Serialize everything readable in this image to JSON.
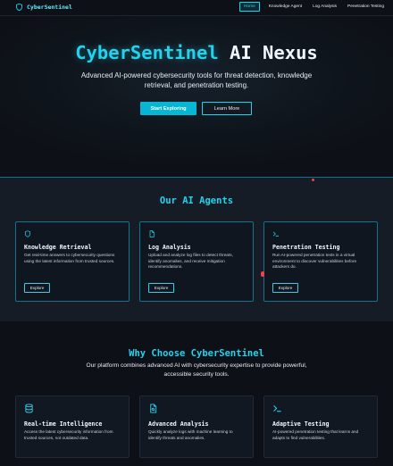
{
  "brand": {
    "name": "CyberSentinel",
    "icon": "shield-icon"
  },
  "nav": {
    "items": [
      {
        "label": "Home",
        "active": true
      },
      {
        "label": "Knowledge Agent",
        "active": false
      },
      {
        "label": "Log Analysis",
        "active": false
      },
      {
        "label": "Penetration Testing",
        "active": false
      }
    ]
  },
  "hero": {
    "title_accent": "CyberSentinel",
    "title_rest": "AI Nexus",
    "subtitle": "Advanced AI-powered cybersecurity tools for threat detection, knowledge retrieval, and penetration testing.",
    "primary_button": "Start Exploring",
    "secondary_button": "Learn More"
  },
  "agents": {
    "heading": "Our AI Agents",
    "cards": [
      {
        "icon": "shield-icon",
        "title": "Knowledge Retrieval",
        "description": "Get real-time answers to cybersecurity questions using the latest information from trusted sources.",
        "button": "Explore"
      },
      {
        "icon": "file-icon",
        "title": "Log Analysis",
        "description": "Upload and analyze log files to detect threats, identify anomalies, and receive mitigation recommendations.",
        "button": "Explore"
      },
      {
        "icon": "terminal-icon",
        "title": "Penetration Testing",
        "description": "Run AI-powered penetration tests in a virtual environment to discover vulnerabilities before attackers do.",
        "button": "Explore"
      }
    ]
  },
  "why": {
    "heading": "Why Choose CyberSentinel",
    "subtitle": "Our platform combines advanced AI with cybersecurity expertise to provide powerful, accessible security tools.",
    "features": [
      {
        "icon": "database-icon",
        "title": "Real-time Intelligence",
        "description": "Access the latest cybersecurity information from trusted sources, not outdated data."
      },
      {
        "icon": "file-search-icon",
        "title": "Advanced Analysis",
        "description": "Quickly analyze logs with machine learning to identify threats and anomalies."
      },
      {
        "icon": "terminal-icon",
        "title": "Adaptive Testing",
        "description": "AI-powered penetration testing that learns and adapts to find vulnerabilities."
      }
    ]
  },
  "colors": {
    "accent": "#22d3ee",
    "button": "#06b6d4",
    "background": "#0d1117",
    "section": "#161c25",
    "card_border": "#0e7490",
    "marker": "#ef4444"
  }
}
